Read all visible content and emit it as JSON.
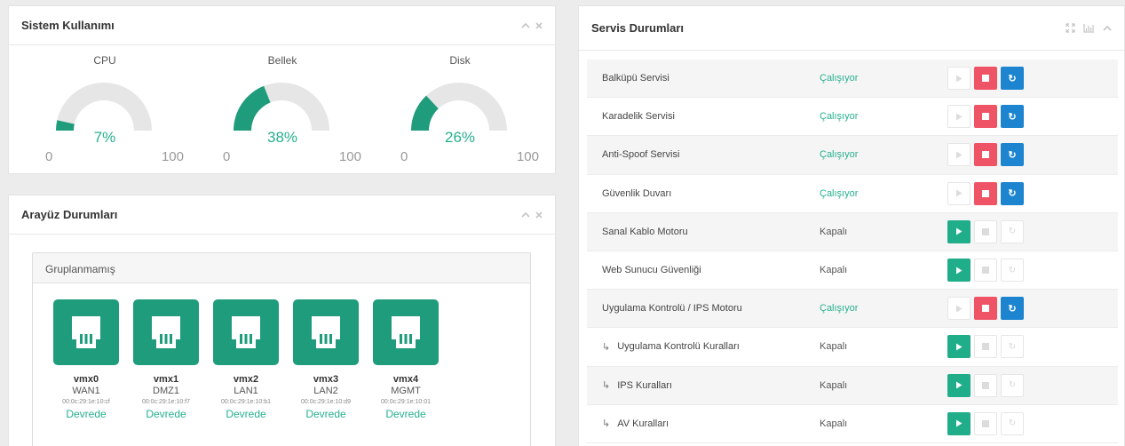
{
  "system_usage": {
    "title": "Sistem Kullanımı",
    "tools": [
      "chevron-up-icon",
      "close-icon"
    ],
    "gauges": [
      {
        "label": "CPU",
        "percent_text": "7%",
        "value": 7,
        "min": "0",
        "max": "100"
      },
      {
        "label": "Bellek",
        "percent_text": "38%",
        "value": 38,
        "min": "0",
        "max": "100"
      },
      {
        "label": "Disk",
        "percent_text": "26%",
        "value": 26,
        "min": "0",
        "max": "100"
      }
    ]
  },
  "interfaces": {
    "title": "Arayüz Durumları",
    "tools": [
      "chevron-up-icon",
      "close-icon"
    ],
    "group_title": "Gruplanmamış",
    "ports": [
      {
        "name": "vmx0",
        "zone": "WAN1",
        "mac": "00:0c:29:1e:10:cf",
        "status": "Devrede"
      },
      {
        "name": "vmx1",
        "zone": "DMZ1",
        "mac": "00:0c:29:1e:10:f7",
        "status": "Devrede"
      },
      {
        "name": "vmx2",
        "zone": "LAN1",
        "mac": "00:0c:29:1e:10:b1",
        "status": "Devrede"
      },
      {
        "name": "vmx3",
        "zone": "LAN2",
        "mac": "00:0c:29:1e:10:d9",
        "status": "Devrede"
      },
      {
        "name": "vmx4",
        "zone": "MGMT",
        "mac": "00:0c:29:1e:10:01",
        "status": "Devrede"
      }
    ]
  },
  "services": {
    "title": "Servis Durumları",
    "tools": [
      "expand-icon",
      "bar-chart-icon",
      "chevron-up-icon"
    ],
    "rows": [
      {
        "name": "Balküpü Servisi",
        "state": "Çalışıyor",
        "running": true,
        "sub": false
      },
      {
        "name": "Karadelik Servisi",
        "state": "Çalışıyor",
        "running": true,
        "sub": false
      },
      {
        "name": "Anti-Spoof Servisi",
        "state": "Çalışıyor",
        "running": true,
        "sub": false
      },
      {
        "name": "Güvenlik Duvarı",
        "state": "Çalışıyor",
        "running": true,
        "sub": false
      },
      {
        "name": "Sanal Kablo Motoru",
        "state": "Kapalı",
        "running": false,
        "sub": false
      },
      {
        "name": "Web Sunucu Güvenliği",
        "state": "Kapalı",
        "running": false,
        "sub": false
      },
      {
        "name": "Uygulama Kontrolü / IPS Motoru",
        "state": "Çalışıyor",
        "running": true,
        "sub": false
      },
      {
        "name": "Uygulama Kontrolü Kuralları",
        "state": "Kapalı",
        "running": false,
        "sub": true
      },
      {
        "name": "IPS Kuralları",
        "state": "Kapalı",
        "running": false,
        "sub": true
      },
      {
        "name": "AV Kuralları",
        "state": "Kapalı",
        "running": false,
        "sub": true
      }
    ]
  },
  "colors": {
    "accent": "#26b08f",
    "port_bg": "#1e9c7c",
    "gauge_track": "#e6e6e6",
    "stop": "#ef5466",
    "restart": "#1d85d0"
  }
}
